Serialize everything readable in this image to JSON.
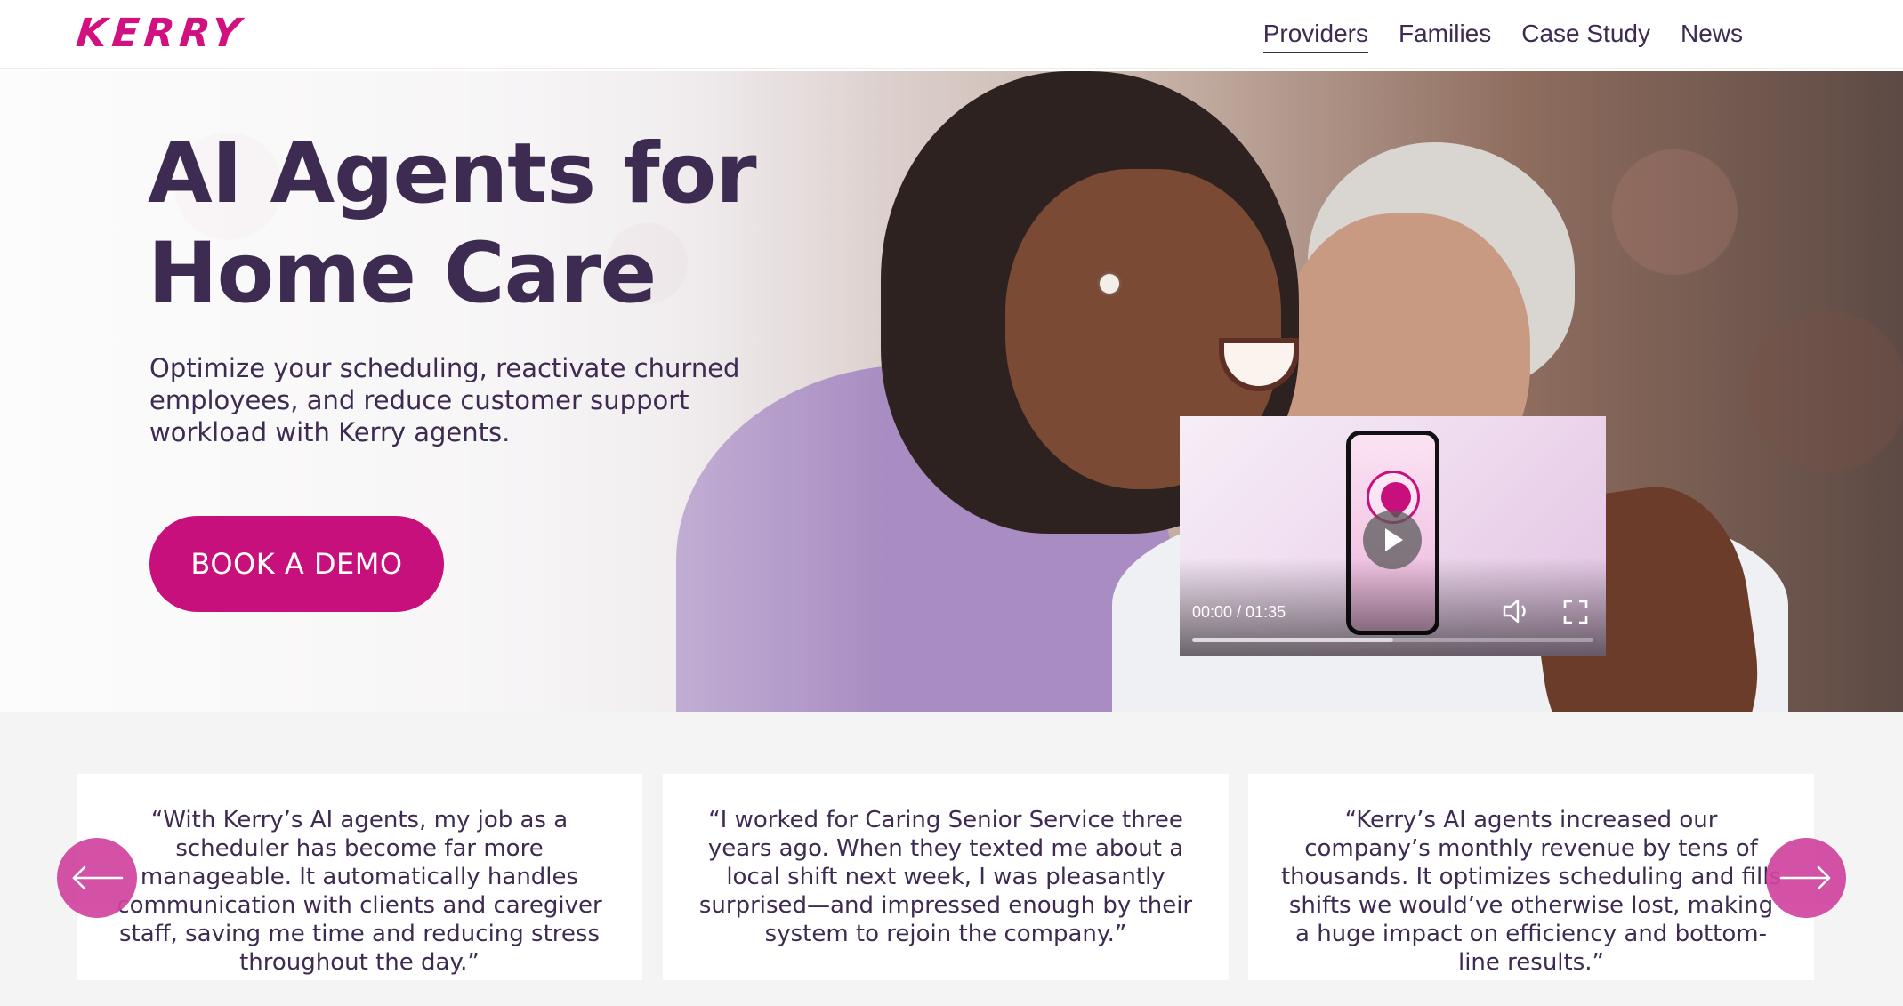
{
  "header": {
    "logo": "KERRY",
    "nav": [
      {
        "label": "Providers",
        "active": true
      },
      {
        "label": "Families",
        "active": false
      },
      {
        "label": "Case Study",
        "active": false
      },
      {
        "label": "News",
        "active": false
      }
    ]
  },
  "hero": {
    "title_line1": "AI Agents for",
    "title_line2": "Home Care",
    "subtitle": "Optimize your scheduling, reactivate churned employees, and reduce customer support workload with Kerry agents.",
    "cta_label": "BOOK A DEMO"
  },
  "video": {
    "time": "00:00 / 01:35",
    "progress": 0,
    "buffered_fraction": 0.5,
    "icons": [
      "play-icon",
      "volume-icon",
      "fullscreen-icon"
    ]
  },
  "testimonials": [
    {
      "quote": "“With Kerry’s AI agents, my job as a scheduler has become far more manageable. It automatically handles communication with clients and caregiver staff, saving me time and reducing stress throughout the day.”"
    },
    {
      "quote": "“I worked for Caring Senior Service three years ago. When they texted me about a local shift next week, I was pleasantly surprised—and impressed enough by their system to rejoin the company.”"
    },
    {
      "quote": "“Kerry’s AI agents increased our company’s monthly revenue by tens of thousands. It optimizes scheduling and fills shifts we would’ve otherwise lost, making a huge impact on efficiency and bottom-line results.”"
    }
  ],
  "carousel": {
    "prev_icon": "arrow-left-icon",
    "next_icon": "arrow-right-icon"
  },
  "colors": {
    "brand": "#c8107c",
    "text": "#3d2b52",
    "arrow": "#d0449e"
  }
}
